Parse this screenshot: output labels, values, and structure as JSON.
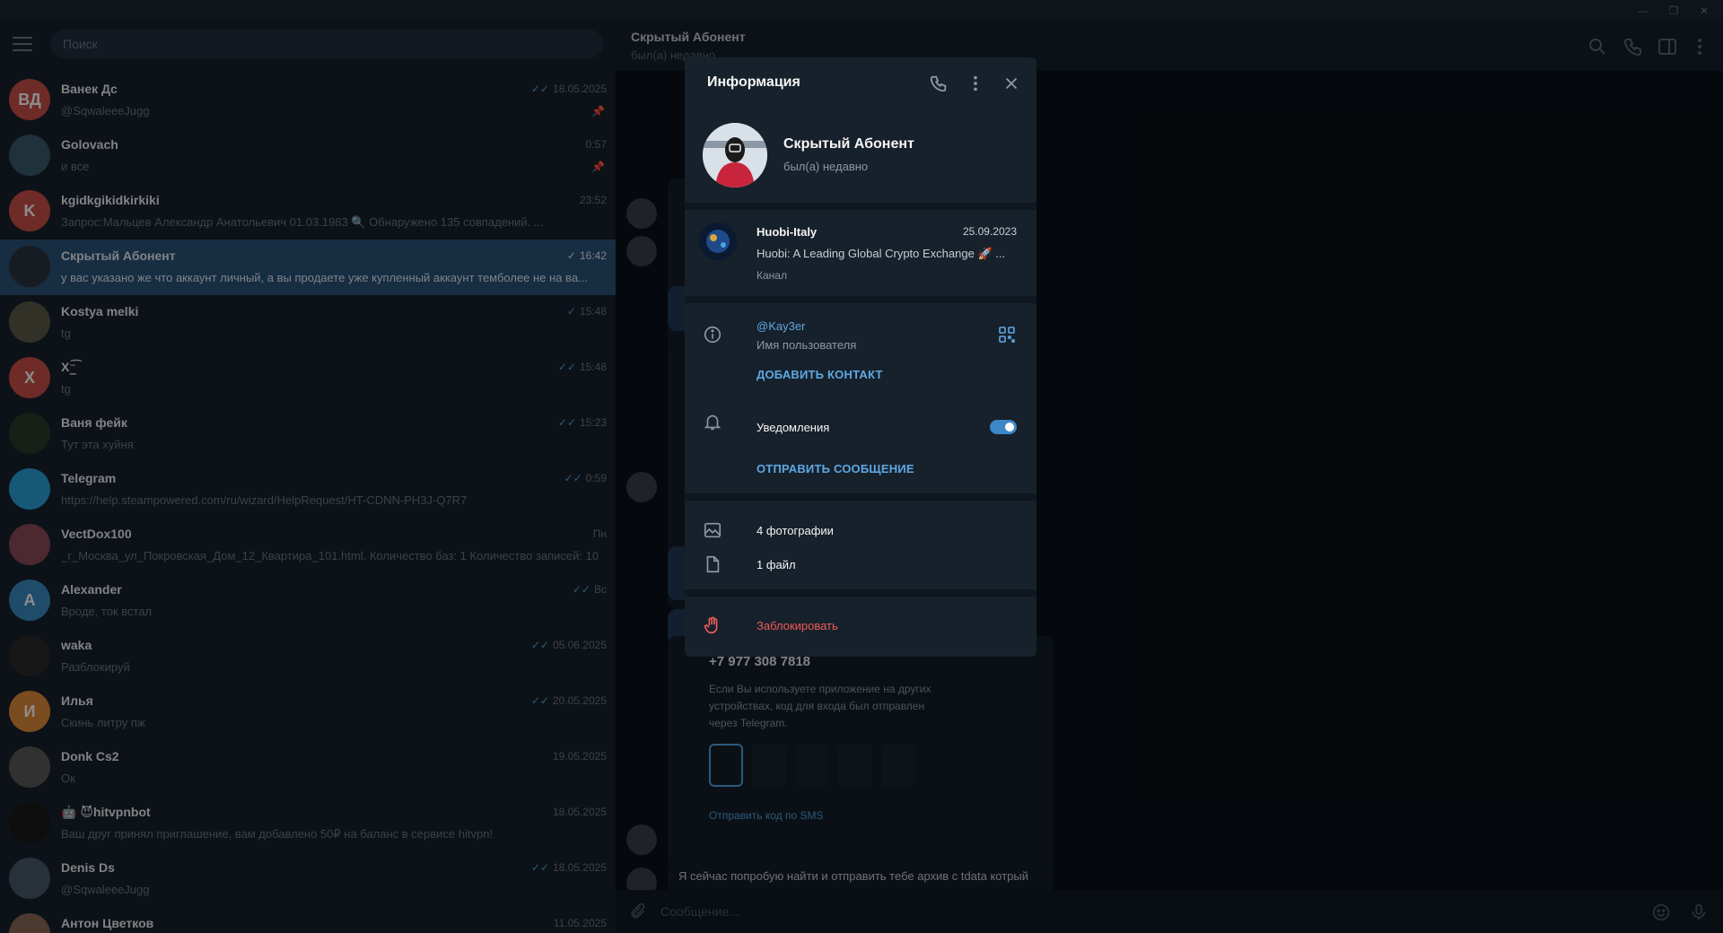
{
  "search": {
    "placeholder": "Поиск"
  },
  "chats": [
    {
      "name": "Ванек Дс",
      "preview": "@SqwaleeeJugg",
      "time": "18.05.2025",
      "initials": "ВД",
      "color": "#c84f48",
      "ticks": "✓✓",
      "pinned": true
    },
    {
      "name": "Golovach",
      "preview": "и все",
      "time": "0:57",
      "initials": "",
      "color": "#3a5a6a",
      "ticks": "",
      "pinned": true
    },
    {
      "name": "kgidkgikidkirkiki",
      "preview": "Запрос:Мальцев Александр Анатольевич 01.03.1983 🔍 Обнаружено 135 совпадений. ...",
      "time": "23:52",
      "initials": "K",
      "color": "#c84f48",
      "ticks": "",
      "pinned": false
    },
    {
      "name": "Скрытый Абонент",
      "preview": "у вас указано же что аккаунт личный, а вы продаете уже купленный аккаунт темболее не на ва...",
      "time": "16:42",
      "initials": "",
      "color": "#2a3440",
      "ticks": "✓",
      "pinned": false
    },
    {
      "name": "Kostya melki",
      "preview": "tg",
      "time": "15:48",
      "initials": "",
      "color": "#5a5a4a",
      "ticks": "✓",
      "pinned": false
    },
    {
      "name": "X⁻̲͡",
      "preview": "tg",
      "time": "15:48",
      "initials": "X",
      "color": "#c84f48",
      "ticks": "✓✓",
      "pinned": false
    },
    {
      "name": "Ваня фейк",
      "preview": "Тут эта хуйня",
      "time": "15:23",
      "initials": "",
      "color": "#2a3a2a",
      "ticks": "✓✓",
      "pinned": false
    },
    {
      "name": "Telegram",
      "preview": "https://help.steampowered.com/ru/wizard/HelpRequest/HT-CDNN-PH3J-Q7R7",
      "time": "0:59",
      "initials": "",
      "color": "#2aa0da",
      "ticks": "✓✓",
      "pinned": false
    },
    {
      "name": "VectDox100",
      "preview": "_г_Москва_ул_Покровская_Дом_12_Квартира_101.html. Количество баз: 1 Количество записей: 10",
      "time": "Пн",
      "initials": "",
      "color": "#8a4a5a",
      "ticks": "",
      "pinned": false
    },
    {
      "name": "Alexander",
      "preview": "Вроде, ток встал",
      "time": "Вс",
      "initials": "A",
      "color": "#3a8ac0",
      "ticks": "✓✓",
      "pinned": false
    },
    {
      "name": "waka",
      "preview": "Разблокируй",
      "time": "05.06.2025",
      "initials": "",
      "color": "#2a2a2a",
      "ticks": "✓✓",
      "pinned": false
    },
    {
      "name": "Илья",
      "preview": "Скинь литру пж",
      "time": "20.05.2025",
      "initials": "И",
      "color": "#e08a3a",
      "ticks": "✓✓",
      "pinned": false
    },
    {
      "name": "Donk Cs2",
      "preview": "Ок",
      "time": "19.05.2025",
      "initials": "",
      "color": "#5a5a5a",
      "ticks": "",
      "pinned": false
    },
    {
      "name": "🤖 😈hitvpnbot",
      "preview": "Ваш друг принял приглашение, вам добавлено 50₽ на баланс в сервисе hitvpn!",
      "time": "18.05.2025",
      "initials": "",
      "color": "#1a1a1a",
      "ticks": "",
      "pinned": false
    },
    {
      "name": "Denis Ds",
      "preview": "@SqwaleeeJugg",
      "time": "18.05.2025",
      "initials": "",
      "color": "#4a5a6a",
      "ticks": "✓✓",
      "pinned": false
    },
    {
      "name": "Антон Цветков",
      "preview": "",
      "time": "11.05.2025",
      "initials": "",
      "color": "#8a6a5a",
      "ticks": "",
      "pinned": false
    }
  ],
  "header": {
    "title": "Скрытый Абонент",
    "status": "был(а) недавно"
  },
  "background_chat": {
    "phone": "+7 977 308 7818",
    "hint": "Если Вы используете приложение на других устройствах, код для входа был отправлен через Telegram.",
    "sms_link": "Отправить код по SMS",
    "last_message": "Я сейчас попробую найти и отправить тебе архив с tdata котрый",
    "input_placeholder": "Сообщение..."
  },
  "dialog": {
    "title": "Информация",
    "name": "Скрытый Абонент",
    "status": "был(а) недавно",
    "channel": {
      "name": "Huobi-Italy",
      "date": "25.09.2023",
      "description": "Huobi: A Leading Global Crypto Exchange 🚀 ...",
      "type": "Канал"
    },
    "username": "@Kay3er",
    "username_label": "Имя пользователя",
    "add_contact": "ДОБАВИТЬ КОНТАКТ",
    "notifications_label": "Уведомления",
    "notifications_on": true,
    "send_message": "ОТПРАВИТЬ СООБЩЕНИЕ",
    "photos": "4 фотографии",
    "files": "1 файл",
    "block": "Заблокировать"
  },
  "colors": {
    "accent": "#5ea8e4",
    "active_chat": "#2b5278",
    "danger": "#ef5b5b"
  }
}
